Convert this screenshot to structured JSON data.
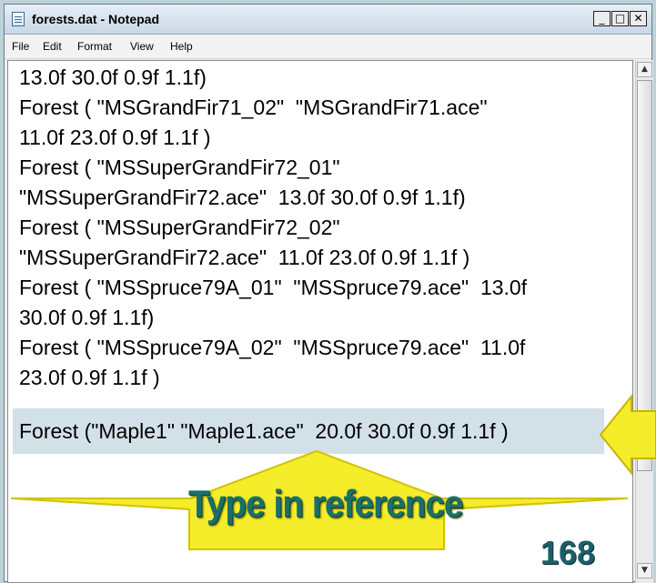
{
  "window": {
    "title": "forests.dat - Notepad",
    "minimize_glyph": "_",
    "maximize_glyph": "□",
    "close_glyph": "✕"
  },
  "menu": {
    "items": [
      "File",
      "Edit",
      "Format",
      "View",
      "Help"
    ]
  },
  "editor": {
    "lines": [
      "13.0f 30.0f 0.9f 1.1f)",
      "Forest ( \"MSGrandFir71_02\"  \"MSGrandFir71.ace\"",
      "11.0f 23.0f 0.9f 1.1f )",
      "Forest ( \"MSSuperGrandFir72_01\"",
      "\"MSSuperGrandFir72.ace\"  13.0f 30.0f 0.9f 1.1f)",
      "Forest ( \"MSSuperGrandFir72_02\"",
      "\"MSSuperGrandFir72.ace\"  11.0f 23.0f 0.9f 1.1f )",
      "Forest ( \"MSSpruce79A_01\"  \"MSSpruce79.ace\"  13.0f",
      "30.0f 0.9f 1.1f)",
      "Forest ( \"MSSpruce79A_02\"  \"MSSpruce79.ace\"  11.0f",
      "23.0f 0.9f 1.1f )"
    ],
    "highlighted_line": "Forest (\"Maple1\" \"Maple1.ace\"  20.0f 30.0f 0.9f 1.1f )"
  },
  "annotation": {
    "label": "Type in reference",
    "arrow_color": "#f5ec2a",
    "text_color": "#1a6f6a"
  },
  "slide_number": "168"
}
